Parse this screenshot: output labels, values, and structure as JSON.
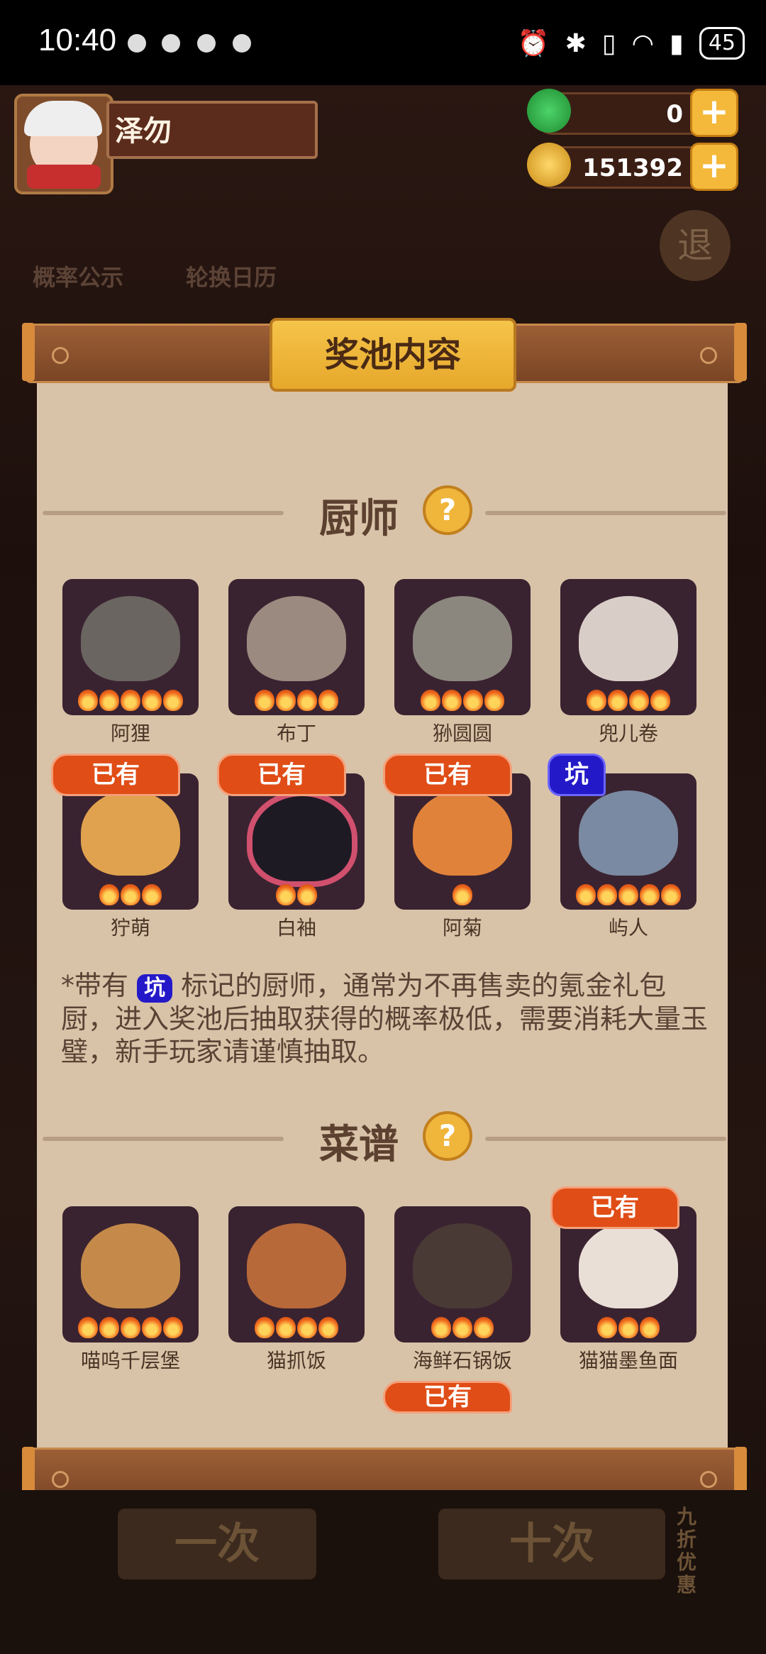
{
  "status_bar": {
    "time": "10:40",
    "battery": "45"
  },
  "player": {
    "name": "泽勿"
  },
  "currencies": [
    {
      "name": "jade",
      "value": "0"
    },
    {
      "name": "coin",
      "value": "151392"
    }
  ],
  "background_buttons": {
    "probability": "概率公示",
    "calendar": "轮换日历",
    "exit": "退"
  },
  "modal": {
    "title": "奖池内容",
    "sections": {
      "chefs": {
        "title": "厨师"
      },
      "recipes": {
        "title": "菜谱"
      }
    },
    "chefs": [
      {
        "name": "阿狸",
        "stars": 5,
        "badge": ""
      },
      {
        "name": "布丁",
        "stars": 4,
        "badge": ""
      },
      {
        "name": "狲圆圆",
        "stars": 4,
        "badge": ""
      },
      {
        "name": "兜儿卷",
        "stars": 4,
        "badge": ""
      },
      {
        "name": "狞萌",
        "stars": 3,
        "badge": "已有"
      },
      {
        "name": "白袖",
        "stars": 2,
        "badge": "已有"
      },
      {
        "name": "阿菊",
        "stars": 1,
        "badge": "已有"
      },
      {
        "name": "屿人",
        "stars": 5,
        "badge": "坑"
      }
    ],
    "note_prefix": "*带有",
    "note_tag": "坑",
    "note_text": "标记的厨师，通常为不再售卖的氪金礼包厨，进入奖池后抽取获得的概率极低，需要消耗大量玉璧，新手玩家请谨慎抽取。",
    "recipes": [
      {
        "name": "喵呜千层堡",
        "stars": 5,
        "badge": ""
      },
      {
        "name": "猫抓饭",
        "stars": 4,
        "badge": ""
      },
      {
        "name": "海鲜石锅饭",
        "stars": 3,
        "badge": ""
      },
      {
        "name": "猫猫墨鱼面",
        "stars": 3,
        "badge": "已有"
      }
    ],
    "partial_badge": "已有"
  },
  "bottom_buttons": {
    "one": "一次",
    "ten": "十次",
    "discount": "九折优惠"
  }
}
